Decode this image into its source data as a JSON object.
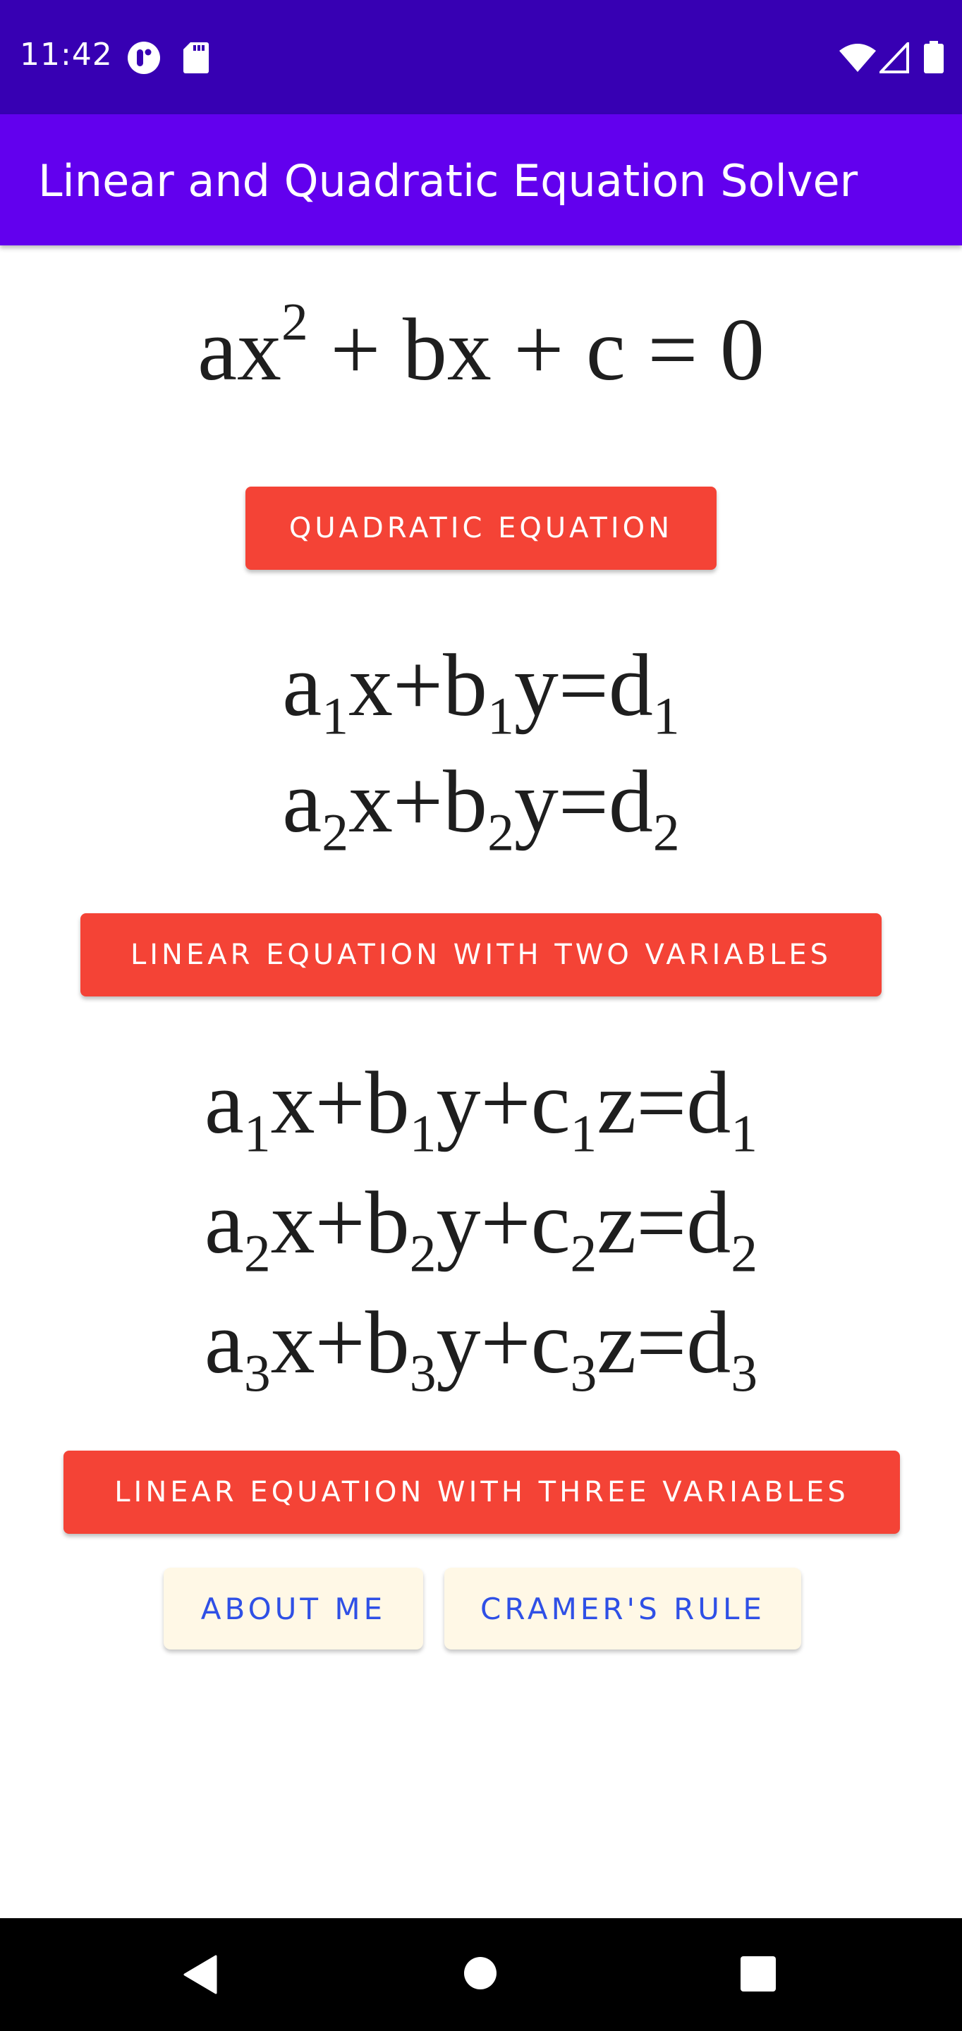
{
  "status_bar": {
    "time": "11:42",
    "left_icons": [
      "app-notification-icon",
      "sd-card-icon"
    ],
    "right_icons": [
      "wifi-icon",
      "cell-signal-icon",
      "battery-icon"
    ]
  },
  "app_bar": {
    "title": "Linear and Quadratic Equation Solver"
  },
  "sections": {
    "quadratic": {
      "equation_image": "ax² + bx + c = 0",
      "button_label": "QUADRATIC EQUATION"
    },
    "linear_two": {
      "equation_lines": [
        "a₁x+b₁y=d₁",
        "a₂x+b₂y=d₂"
      ],
      "button_label": "LINEAR EQUATION WITH TWO VARIABLES"
    },
    "linear_three": {
      "equation_lines": [
        "a₁x+b₁y+c₁z=d₁",
        "a₂x+b₂y+c₂z=d₂",
        "a₃x+b₃y+c₃z=d₃"
      ],
      "button_label": "LINEAR EQUATION WITH THREE VARIABLES"
    }
  },
  "footer_buttons": {
    "about_me": "ABOUT ME",
    "cramers_rule": "CRAMER'S RULE"
  },
  "nav_bar": {
    "icons": [
      "back-icon",
      "home-icon",
      "recents-icon"
    ]
  },
  "colors": {
    "status_bar": "#3700b3",
    "app_bar": "#6200ee",
    "primary_button": "#f44336",
    "secondary_button_bg": "#fff8e6",
    "secondary_button_text": "#2f50e6"
  }
}
